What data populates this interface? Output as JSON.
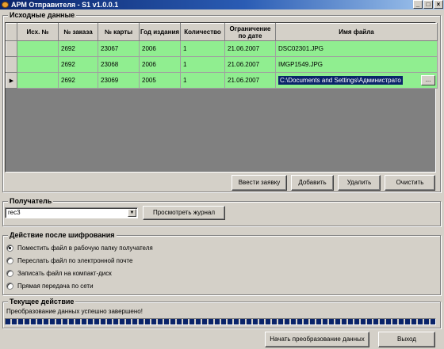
{
  "window": {
    "title": "АРМ Отправителя - S1 v1.0.0.1",
    "controls": [
      "_",
      "□",
      "×"
    ]
  },
  "source_group": {
    "title": "Исходные данные",
    "columns": [
      "Исх. №",
      "№ заказа",
      "№ карты",
      "Год издания",
      "Количество",
      "Ограничение по дате",
      "Имя файла"
    ],
    "rows": [
      {
        "indicator": "",
        "ref": "",
        "order": "2692",
        "card": "23067",
        "year": "2006",
        "qty": "1",
        "date": "21.06.2007",
        "file": "DSC02301.JPG"
      },
      {
        "indicator": "",
        "ref": "",
        "order": "2692",
        "card": "23068",
        "year": "2006",
        "qty": "1",
        "date": "21.06.2007",
        "file": "IMGP1549.JPG"
      },
      {
        "indicator": "▶",
        "ref": "",
        "order": "2692",
        "card": "23069",
        "year": "2005",
        "qty": "1",
        "date": "21.06.2007",
        "file": "C:\\Documents and Settings\\Администрато"
      }
    ],
    "ellipsis_label": "...",
    "buttons": {
      "enter_order": "Ввести заявку",
      "add": "Добавить",
      "delete": "Удалить",
      "clear": "Очистить"
    }
  },
  "recipient_group": {
    "title": "Получатель",
    "selected": "rec3",
    "view_log": "Просмотреть журнал"
  },
  "action_group": {
    "title": "Действие после шифрования",
    "options": [
      {
        "label": "Поместить файл в рабочую папку получателя",
        "checked": true
      },
      {
        "label": "Переслать файл по электронной почте",
        "checked": false
      },
      {
        "label": "Записать файл на компакт-диск",
        "checked": false
      },
      {
        "label": "Прямая передача по сети",
        "checked": false
      }
    ]
  },
  "current_group": {
    "title": "Текущее действие",
    "status": "Преобразование данных успешно завершено!",
    "progress": 1.0
  },
  "footer": {
    "start": "Начать преобразование данных",
    "exit": "Выход"
  }
}
